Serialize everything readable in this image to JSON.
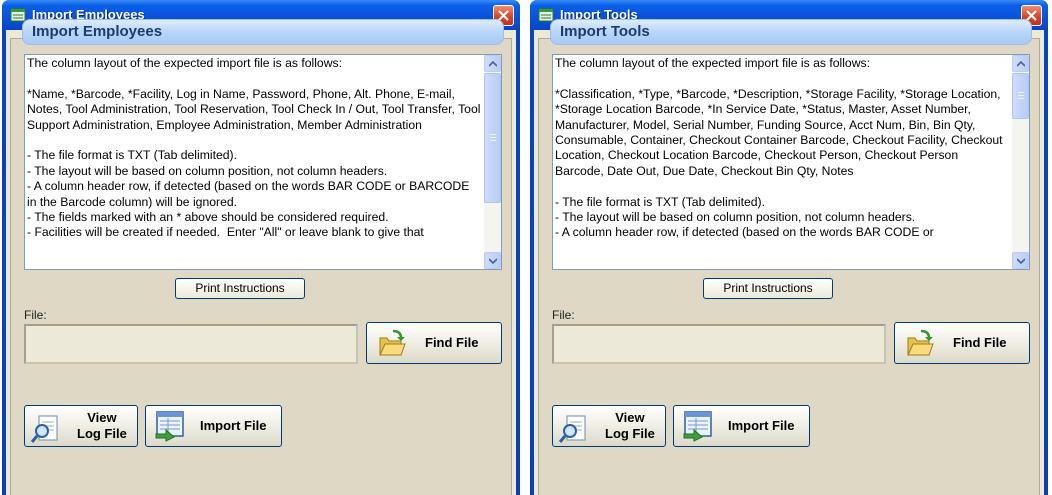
{
  "windows": [
    {
      "title": "Import Employees",
      "header": "Import Employees",
      "instructions": "The column layout of the expected import file is as follows:\n\n*Name, *Barcode, *Facility, Log in Name, Password, Phone, Alt. Phone, E-mail, Notes, Tool Administration, Tool Reservation, Tool Check In / Out, Tool Transfer, Tool Support Administration, Employee Administration, Member Administration\n\n- The file format is TXT (Tab delimited).\n- The layout will be based on column position, not column headers.\n- A column header row, if detected (based on the words BAR CODE or BARCODE in the Barcode column) will be ignored.\n- The fields marked with an * above should be considered required.\n- Facilities will be created if needed.  Enter \"All\" or leave blank to give that",
      "print_label": "Print Instructions",
      "file_label": "File:",
      "file_value": "",
      "find_label": "Find File",
      "view_label_1": "View",
      "view_label_2": "Log File",
      "import_label": "Import File"
    },
    {
      "title": "Import Tools",
      "header": "Import Tools",
      "instructions": "The column layout of the expected import file is as follows:\n\n*Classification, *Type, *Barcode, *Description, *Storage Facility, *Storage Location, *Storage Location Barcode, *In Service Date, *Status, Master, Asset Number, Manufacturer, Model, Serial Number, Funding Source, Acct Num, Bin, Bin Qty, Consumable, Container, Checkout Container Barcode, Checkout Facility, Checkout Location, Checkout Location Barcode, Checkout Person, Checkout Person Barcode, Date Out, Due Date, Checkout Bin Qty, Notes\n\n- The file format is TXT (Tab delimited).\n- The layout will be based on column position, not column headers.\n- A column header row, if detected (based on the words BAR CODE or",
      "print_label": "Print Instructions",
      "file_label": "File:",
      "file_value": "",
      "find_label": "Find File",
      "view_label_1": "View",
      "view_label_2": "Log File",
      "import_label": "Import File"
    }
  ],
  "colors": {
    "titlebar": "#0852d8",
    "client": "#ece9d8",
    "header_text": "#1e3a6e",
    "close_button": "#d8452a"
  },
  "icons": [
    "app-icon",
    "close-icon",
    "scroll-up-icon",
    "scroll-down-icon",
    "folder-open-icon",
    "magnifier-log-icon",
    "import-sheet-icon"
  ]
}
